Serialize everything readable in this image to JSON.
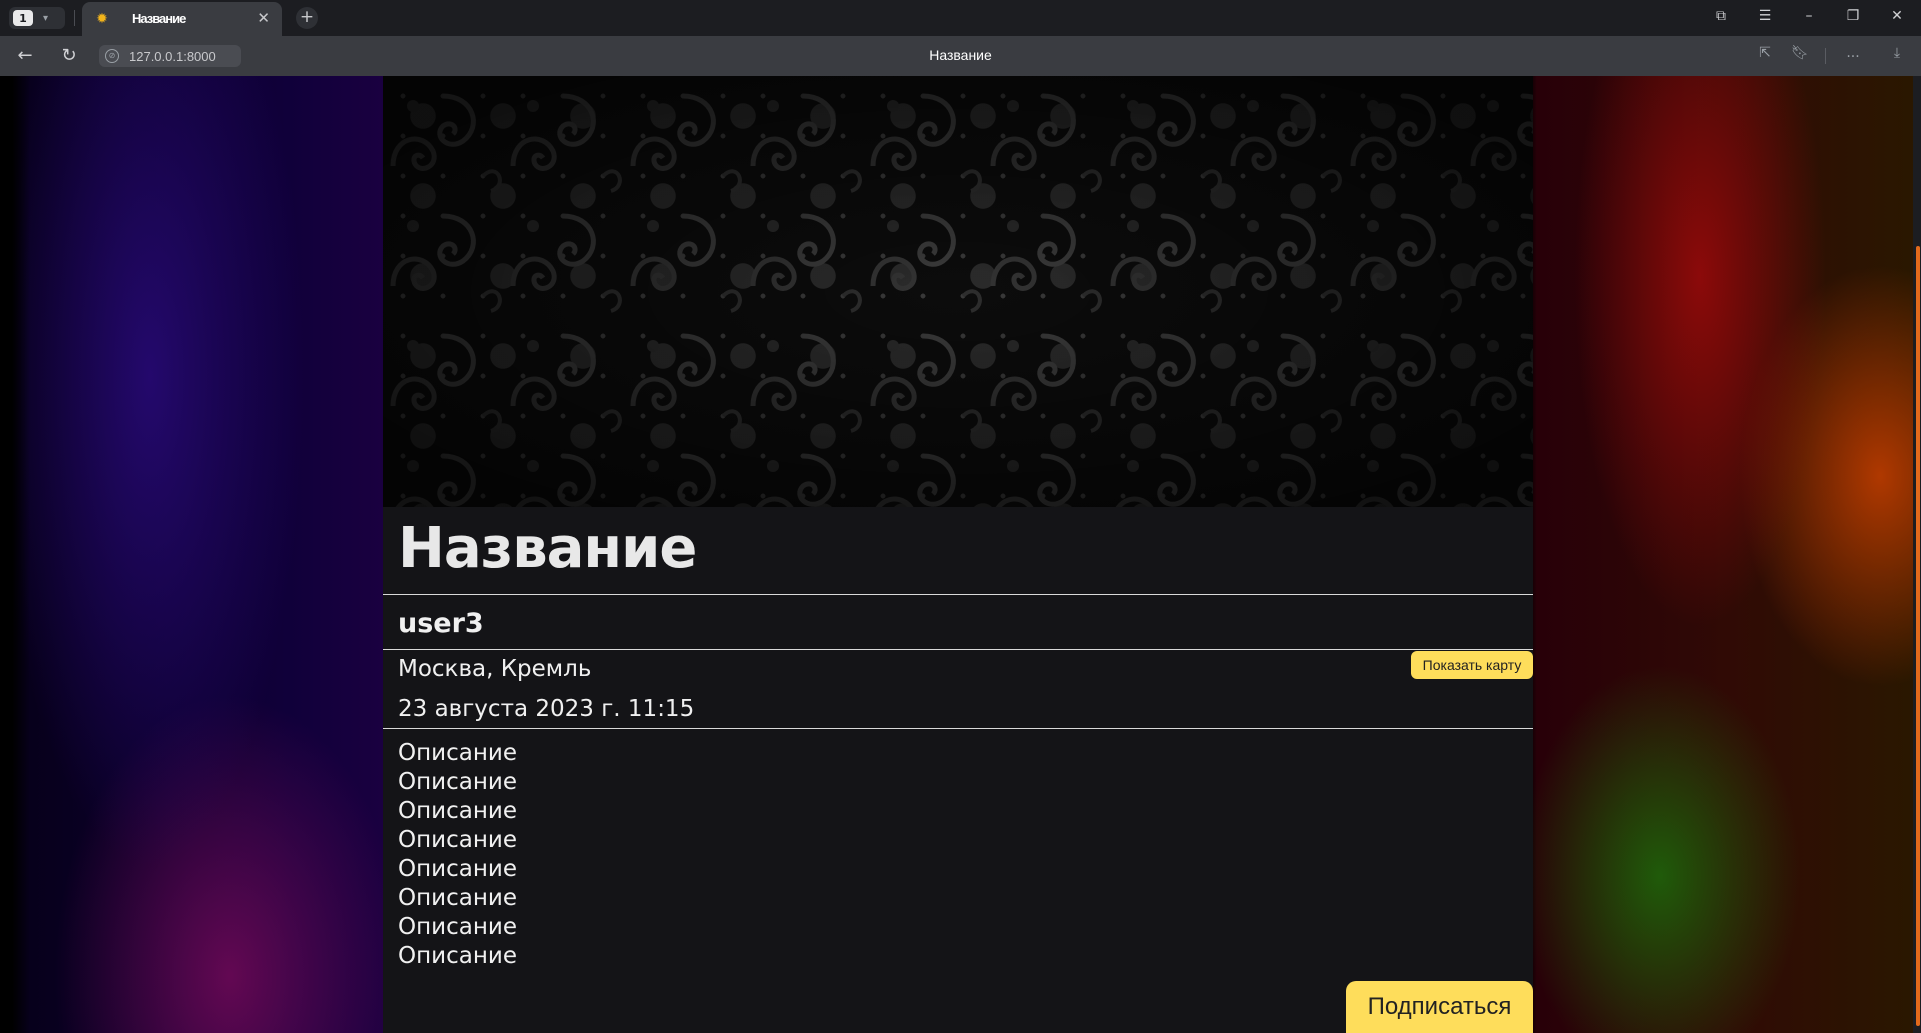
{
  "browser": {
    "tab_count": "1",
    "tab_title": "Название",
    "url": "127.0.0.1:8000",
    "page_title": "Название",
    "new_tab_symbol": "+",
    "more_symbol": "..."
  },
  "post": {
    "title": "Название",
    "author": "user3",
    "location": "Москва, Кремль",
    "datetime": "23 августа 2023 г. 11:15",
    "show_map_label": "Показать карту",
    "description_lines": [
      "Описание",
      "Описание",
      "Описание",
      "Описание",
      "Описание",
      "Описание",
      "Описание",
      "Описание"
    ],
    "subscribe_label": "Подписаться"
  },
  "colors": {
    "accent_button": "#fedd5b",
    "content_bg": "#141417",
    "scrollbar_thumb": "#e36a1c"
  },
  "icons": [
    "tab-favicon-icon",
    "close-icon",
    "back-icon",
    "reload-icon",
    "site-info-icon",
    "share-icon",
    "bookmark-icon",
    "download-icon",
    "minimize-icon",
    "maximize-icon",
    "window-close-icon",
    "collections-icon",
    "menu-icon"
  ]
}
